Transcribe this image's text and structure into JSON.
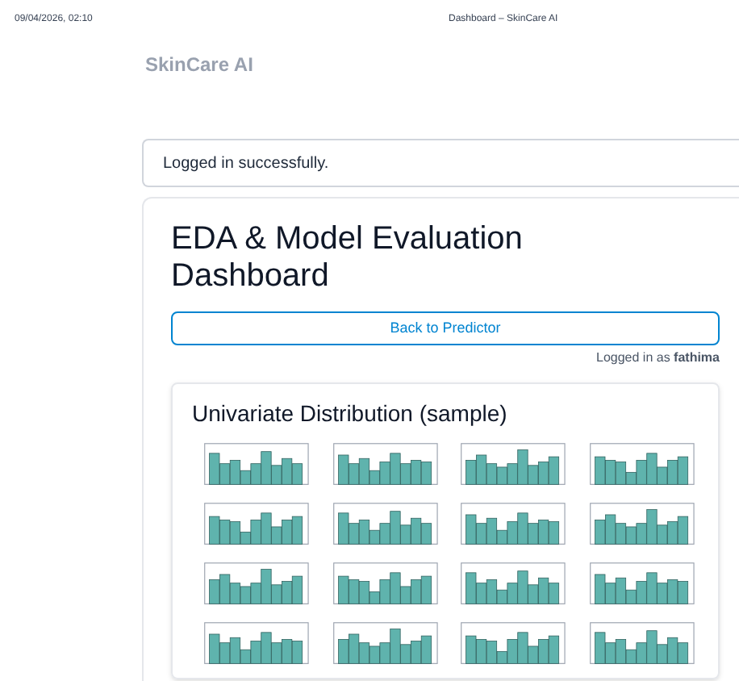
{
  "print_header": {
    "date_time": "09/04/2026, 02:10",
    "page_title": "Dashboard – SkinCare AI"
  },
  "brand": "SkinCare AI",
  "alert": "Logged in successfully.",
  "dashboard": {
    "title": "EDA & Model Evaluation Dashboard",
    "back_button": "Back to Predictor",
    "logged_in_prefix": "Logged in as",
    "username": "fathima",
    "section": {
      "title": "Univariate Distribution (sample)"
    }
  }
}
